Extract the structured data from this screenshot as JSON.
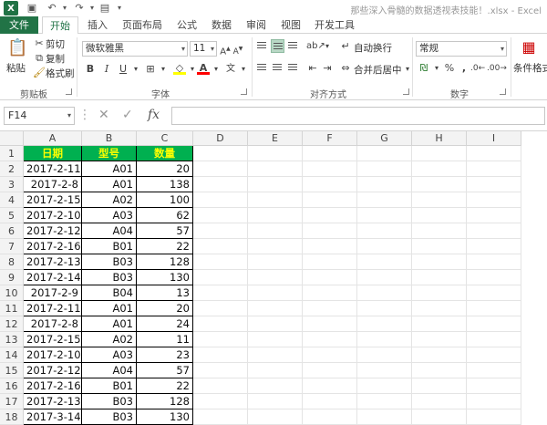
{
  "titlebar": {
    "app_logo": "X",
    "doc_title": "那些深入骨髓的数据透视表技能！.xlsx - Excel"
  },
  "tabs": [
    {
      "label": "文件"
    },
    {
      "label": "开始"
    },
    {
      "label": "插入"
    },
    {
      "label": "页面布局"
    },
    {
      "label": "公式"
    },
    {
      "label": "数据"
    },
    {
      "label": "审阅"
    },
    {
      "label": "视图"
    },
    {
      "label": "开发工具"
    }
  ],
  "ribbon": {
    "clipboard": {
      "paste": "粘贴",
      "cut": "剪切",
      "copy": "复制",
      "format_painter": "格式刷",
      "label": "剪贴板"
    },
    "font": {
      "font_name": "微软雅黑",
      "font_size": "11",
      "label": "字体"
    },
    "alignment": {
      "wrap_text": "自动换行",
      "merge_center": "合并后居中",
      "label": "对齐方式"
    },
    "number": {
      "format": "常规",
      "label": "数字"
    },
    "styles": {
      "conditional_format": "条件格式"
    }
  },
  "formula_bar": {
    "name_box": "F14",
    "fx": "fx",
    "value": ""
  },
  "grid": {
    "columns": [
      "A",
      "B",
      "C",
      "D",
      "E",
      "F",
      "G",
      "H",
      "I"
    ],
    "headers": [
      "日期",
      "型号",
      "数量"
    ],
    "rows": [
      {
        "n": "2",
        "date": "2017-2-11",
        "model": "A01",
        "qty": "20"
      },
      {
        "n": "3",
        "date": "2017-2-8",
        "model": "A01",
        "qty": "138"
      },
      {
        "n": "4",
        "date": "2017-2-15",
        "model": "A02",
        "qty": "100"
      },
      {
        "n": "5",
        "date": "2017-2-10",
        "model": "A03",
        "qty": "62"
      },
      {
        "n": "6",
        "date": "2017-2-12",
        "model": "A04",
        "qty": "57"
      },
      {
        "n": "7",
        "date": "2017-2-16",
        "model": "B01",
        "qty": "22"
      },
      {
        "n": "8",
        "date": "2017-2-13",
        "model": "B03",
        "qty": "128"
      },
      {
        "n": "9",
        "date": "2017-2-14",
        "model": "B03",
        "qty": "130"
      },
      {
        "n": "10",
        "date": "2017-2-9",
        "model": "B04",
        "qty": "13"
      },
      {
        "n": "11",
        "date": "2017-2-11",
        "model": "A01",
        "qty": "20"
      },
      {
        "n": "12",
        "date": "2017-2-8",
        "model": "A01",
        "qty": "24"
      },
      {
        "n": "13",
        "date": "2017-2-15",
        "model": "A02",
        "qty": "11"
      },
      {
        "n": "14",
        "date": "2017-2-10",
        "model": "A03",
        "qty": "23"
      },
      {
        "n": "15",
        "date": "2017-2-12",
        "model": "A04",
        "qty": "57"
      },
      {
        "n": "16",
        "date": "2017-2-16",
        "model": "B01",
        "qty": "22"
      },
      {
        "n": "17",
        "date": "2017-2-13",
        "model": "B03",
        "qty": "128"
      },
      {
        "n": "18",
        "date": "2017-3-14",
        "model": "B03",
        "qty": "130"
      }
    ],
    "header_row_number": "1"
  },
  "colors": {
    "excel_green": "#217346",
    "header_fill": "#00b050",
    "header_text": "#ffff00"
  }
}
